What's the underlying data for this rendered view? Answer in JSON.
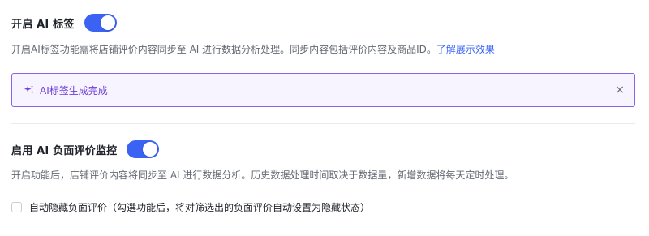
{
  "ai_tags": {
    "title": "开启 AI 标签",
    "toggle_on": true,
    "description": "开启AI标签功能需将店铺评价内容同步至 AI 进行数据分析处理。同步内容包括评价内容及商品ID。",
    "link_text": "了解展示效果"
  },
  "banner": {
    "text": "AI标签生成完成",
    "icon": "sparkle-icon",
    "close_label": "×"
  },
  "negative_monitor": {
    "title": "启用 AI 负面评价监控",
    "toggle_on": true,
    "description": "开启功能后，店铺评价内容将同步至 AI 进行数据分析。历史数据处理时间取决于数据量，新增数据将每天定时处理。",
    "checkbox_label": "自动隐藏负面评价（勾選功能后，将对筛选出的负面评价自动设置为隐藏状态）",
    "checkbox_checked": false
  },
  "colors": {
    "accent": "#3b63f3",
    "banner_border": "#8a63e6",
    "banner_text": "#6c3fd6"
  }
}
